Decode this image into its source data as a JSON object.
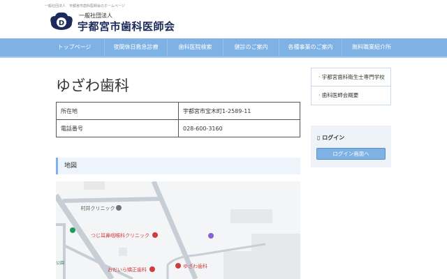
{
  "header": {
    "tagline": "一般社団法人　宇都宮市歯科医師会のホームページ",
    "org_small": "一般社団法人",
    "org_name": "宇都宮市歯科医師会"
  },
  "nav": [
    "トップページ",
    "夜間休日救急診療",
    "歯科医院検索",
    "健診のご案内",
    "各種事業のご案内",
    "無料職業紹介所"
  ],
  "page": {
    "title": "ゆざわ歯科",
    "table": [
      {
        "key": "所在地",
        "value": "宇都宮市宝木町1-2589-11"
      },
      {
        "key": "電話番号",
        "value": "028-600-3160"
      }
    ],
    "map_heading": "地図"
  },
  "map": {
    "labels": {
      "murai": "村井クリニック",
      "tsuji": "つじ耳鼻咽喉科クリニック",
      "odaira": "おだいら矯正歯科",
      "yuzawa": "ゆざわ歯科",
      "park": "公園"
    }
  },
  "sidebar": {
    "links": [
      "宇都宮歯科衛生士専門学校",
      "歯科医師会概要"
    ],
    "login_label": "ログイン",
    "login_button": "ログイン画面へ"
  },
  "colors": {
    "nav": "#7eb2e4",
    "accent": "#1a2a5a",
    "map_pin": "#d23b3b"
  }
}
